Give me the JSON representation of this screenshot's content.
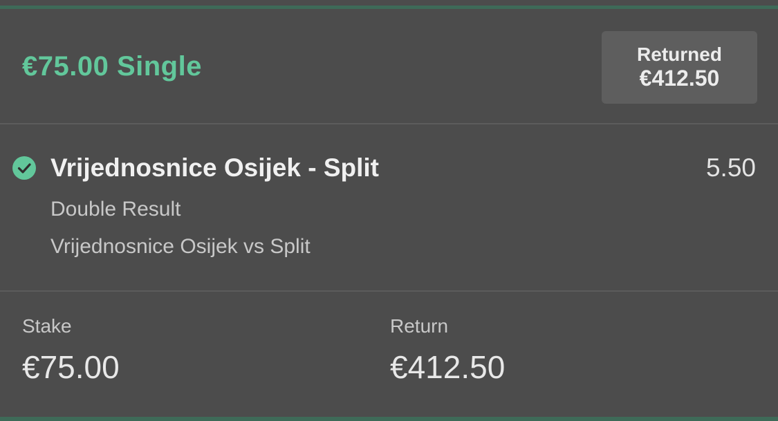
{
  "header": {
    "title": "€75.00 Single",
    "returned_label": "Returned",
    "returned_amount": "€412.50"
  },
  "selection": {
    "status_icon": "check-circle-icon",
    "name": "Vrijednosnice Osijek - Split",
    "odds": "5.50",
    "market": "Double Result",
    "event": "Vrijednosnice Osijek vs Split"
  },
  "summary": {
    "stake_label": "Stake",
    "stake_value": "€75.00",
    "return_label": "Return",
    "return_value": "€412.50"
  },
  "colors": {
    "background": "#4c4c4c",
    "accent_green": "#62c79b",
    "badge_bg": "#5e5e5e",
    "divider": "#5c5c5c"
  }
}
